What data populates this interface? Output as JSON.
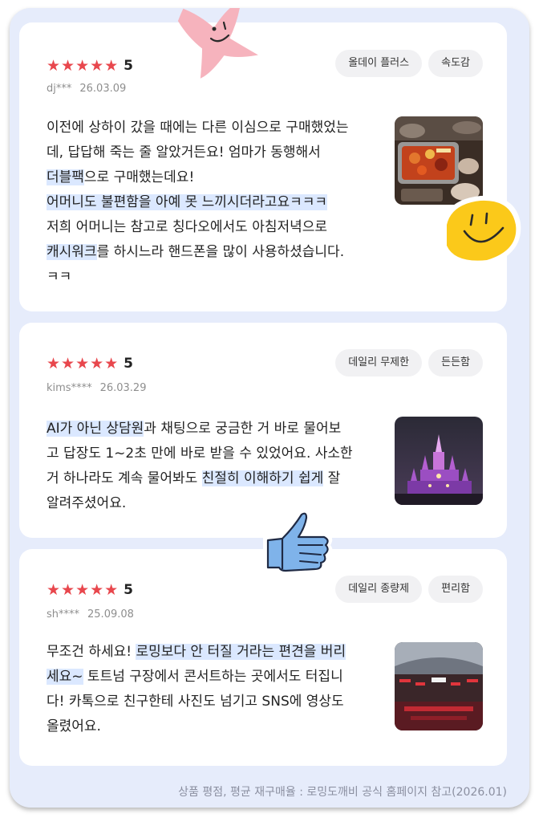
{
  "reviews": [
    {
      "stars": "★★★★★",
      "rating": "5",
      "user": "dj***",
      "date": "26.03.09",
      "tags": [
        "올데이 플러스",
        "속도감"
      ],
      "text": [
        {
          "t": "이전에 상하이 갔을 때에는 다른 이심으로 구매했었는\n데, 답답해 죽는 줄 알았거든요! 엄마가 동행해서\n",
          "hl": false
        },
        {
          "t": "더블팩",
          "hl": true
        },
        {
          "t": "으로 구매했는데요!\n",
          "hl": false
        },
        {
          "t": "어머니도 불편함을 아예 못 느끼시더라고요ㅋㅋㅋ",
          "hl": true
        },
        {
          "t": "\n저희 어머니는 참고로 칭다오에서도 아침저녁으로\n",
          "hl": false
        },
        {
          "t": "캐시워크",
          "hl": true
        },
        {
          "t": "를 하시느라 핸드폰을 많이 사용하셨습니다.\nㅋㅋ",
          "hl": false
        }
      ]
    },
    {
      "stars": "★★★★★",
      "rating": "5",
      "user": "kims****",
      "date": "26.03.29",
      "tags": [
        "데일리 무제한",
        "든든함"
      ],
      "text": [
        {
          "t": "AI가 아닌 상담원",
          "hl": true
        },
        {
          "t": "과 채팅으로 궁금한 거 바로 물어보\n고 답장도 1~2초 만에 바로 받을 수 있었어요. 사소한\n거 하나라도 계속 물어봐도 ",
          "hl": false
        },
        {
          "t": "친절히 이해하기 쉽게",
          "hl": true
        },
        {
          "t": " 잘\n알려주셨어요.",
          "hl": false
        }
      ]
    },
    {
      "stars": "★★★★★",
      "rating": "5",
      "user": "sh****",
      "date": "25.09.08",
      "tags": [
        "데일리 종량제",
        "편리함"
      ],
      "text": [
        {
          "t": "무조건 하세요! ",
          "hl": false
        },
        {
          "t": "로밍보다 안 터질 거라는 편견을 버리\n세요~",
          "hl": true
        },
        {
          "t": "  토트넘 구장에서 콘서트하는 곳에서도 터집니\n다! 카톡으로 친구한테 사진도 넘기고 SNS에 영상도\n올렸어요.",
          "hl": false
        }
      ]
    }
  ],
  "footer": "상품 평점, 평균 재구매율 : 로밍도깨비 공식 홈페이지 참고(2026.01)",
  "stickers": [
    "pink-star-face",
    "yellow-smiley-face",
    "blue-thumbs-up"
  ],
  "colors": {
    "background": "#e6ecfb",
    "star": "#e8474d",
    "highlight": "#dbe8ff"
  }
}
